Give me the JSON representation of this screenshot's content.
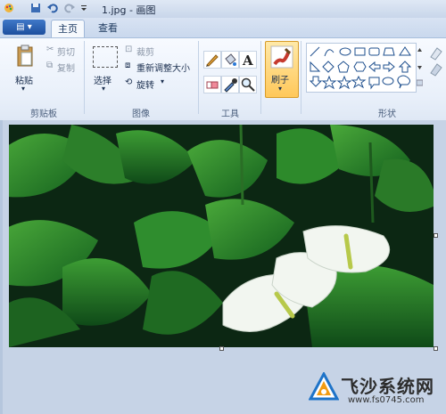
{
  "window": {
    "title": "1.jpg - 画图"
  },
  "tabs": [
    {
      "label": "主页",
      "active": true
    },
    {
      "label": "查看",
      "active": false
    }
  ],
  "clipboard": {
    "group_label": "剪贴板",
    "paste_label": "粘贴",
    "cut_label": "剪切",
    "copy_label": "复制"
  },
  "image": {
    "group_label": "图像",
    "select_label": "选择",
    "crop_label": "裁剪",
    "resize_label": "重新调整大小",
    "rotate_label": "旋转"
  },
  "tools": {
    "group_label": "工具",
    "items": [
      "pencil-icon",
      "fill-icon",
      "text-icon",
      "eraser-icon",
      "color-picker-icon",
      "magnifier-icon"
    ]
  },
  "brushes": {
    "label": "刷子"
  },
  "shapes": {
    "group_label": "形状"
  },
  "watermark": {
    "title": "飞沙系统网",
    "url": "www.fs0745.com"
  },
  "colors": {
    "accent": "#ffc85a",
    "ribbon": "#e9f0fa",
    "canvas": "#c6d3e6"
  }
}
